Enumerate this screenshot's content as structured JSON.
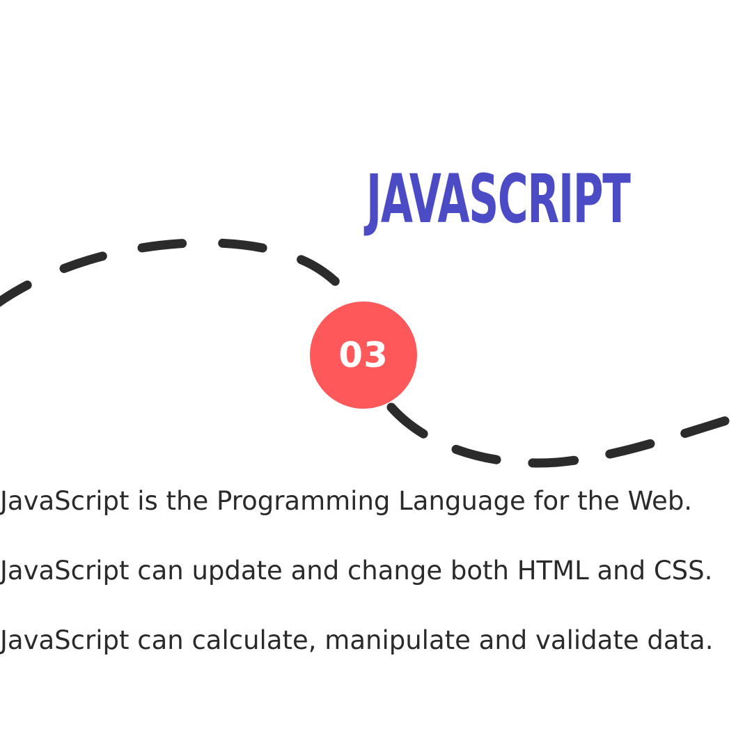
{
  "title": "JAVASCRIPT",
  "step_number": "03",
  "lines": [
    "JavaScript is the Programming Language for the Web.",
    "JavaScript can update and change both HTML and CSS.",
    "JavaScript can calculate, manipulate and validate data."
  ],
  "colors": {
    "title": "#4b4bc6",
    "badge": "#ff585a",
    "dashes": "#2b2b2b",
    "text": "#2a2a2a",
    "background": "#ffffff"
  }
}
